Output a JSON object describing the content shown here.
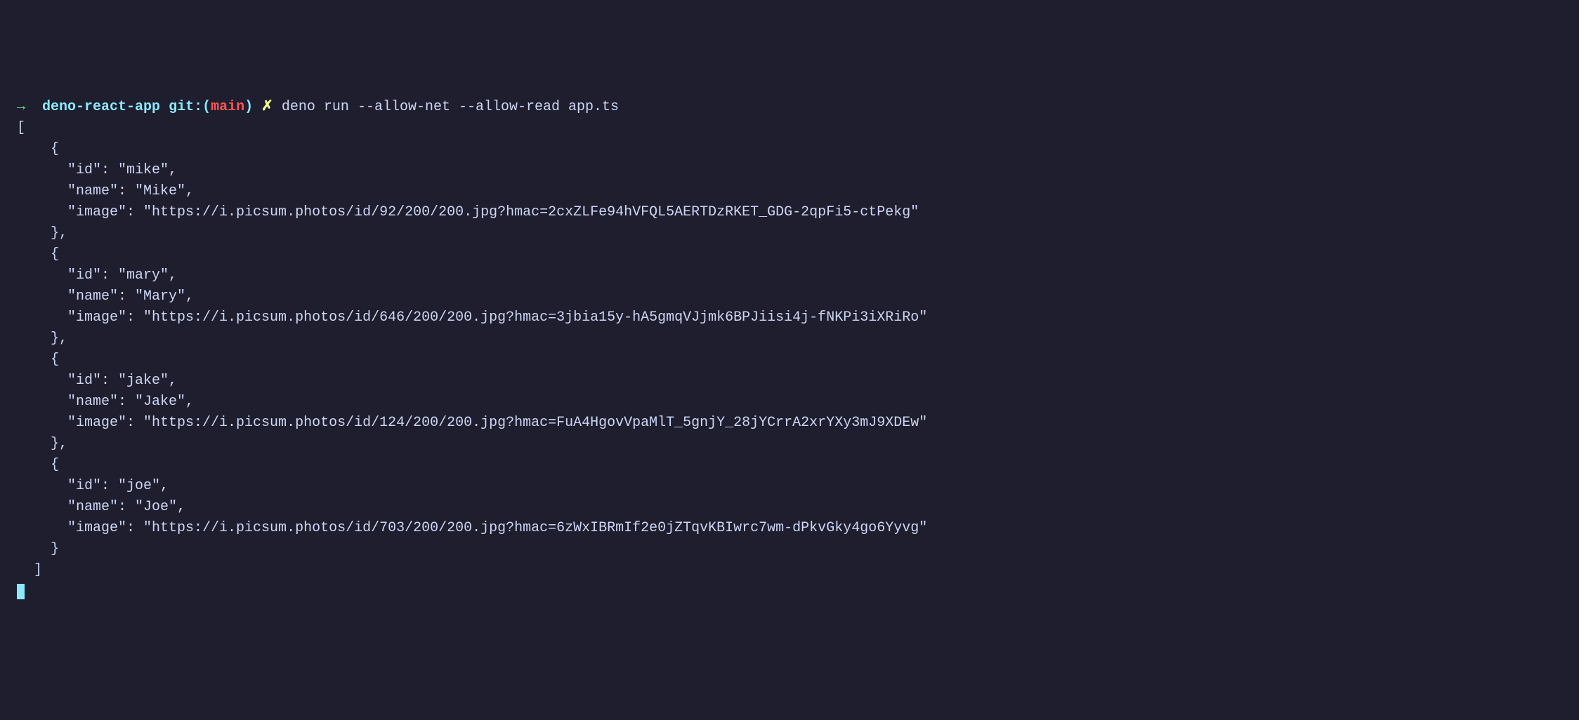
{
  "prompt": {
    "arrow": "→",
    "directory": "deno-react-app",
    "git_label": "git:(",
    "branch": "main",
    "git_close": ")",
    "symbol": "✗",
    "command": "deno run --allow-net --allow-read app.ts"
  },
  "output": {
    "line0": "[",
    "line1": "    {",
    "line2": "      \"id\": \"mike\",",
    "line3": "      \"name\": \"Mike\",",
    "line4": "      \"image\": \"https://i.picsum.photos/id/92/200/200.jpg?hmac=2cxZLFe94hVFQL5AERTDzRKET_GDG-2qpFi5-ctPekg\"",
    "line5": "    },",
    "line6": "    {",
    "line7": "      \"id\": \"mary\",",
    "line8": "      \"name\": \"Mary\",",
    "line9": "      \"image\": \"https://i.picsum.photos/id/646/200/200.jpg?hmac=3jbia15y-hA5gmqVJjmk6BPJiisi4j-fNKPi3iXRiRo\"",
    "line10": "    },",
    "line11": "    {",
    "line12": "      \"id\": \"jake\",",
    "line13": "      \"name\": \"Jake\",",
    "line14": "      \"image\": \"https://i.picsum.photos/id/124/200/200.jpg?hmac=FuA4HgovVpaMlT_5gnjY_28jYCrrA2xrYXy3mJ9XDEw\"",
    "line15": "    },",
    "line16": "    {",
    "line17": "      \"id\": \"joe\",",
    "line18": "      \"name\": \"Joe\",",
    "line19": "      \"image\": \"https://i.picsum.photos/id/703/200/200.jpg?hmac=6zWxIBRmIf2e0jZTqvKBIwrc7wm-dPkvGky4go6Yyvg\"",
    "line20": "    }",
    "line21": "  ]"
  }
}
